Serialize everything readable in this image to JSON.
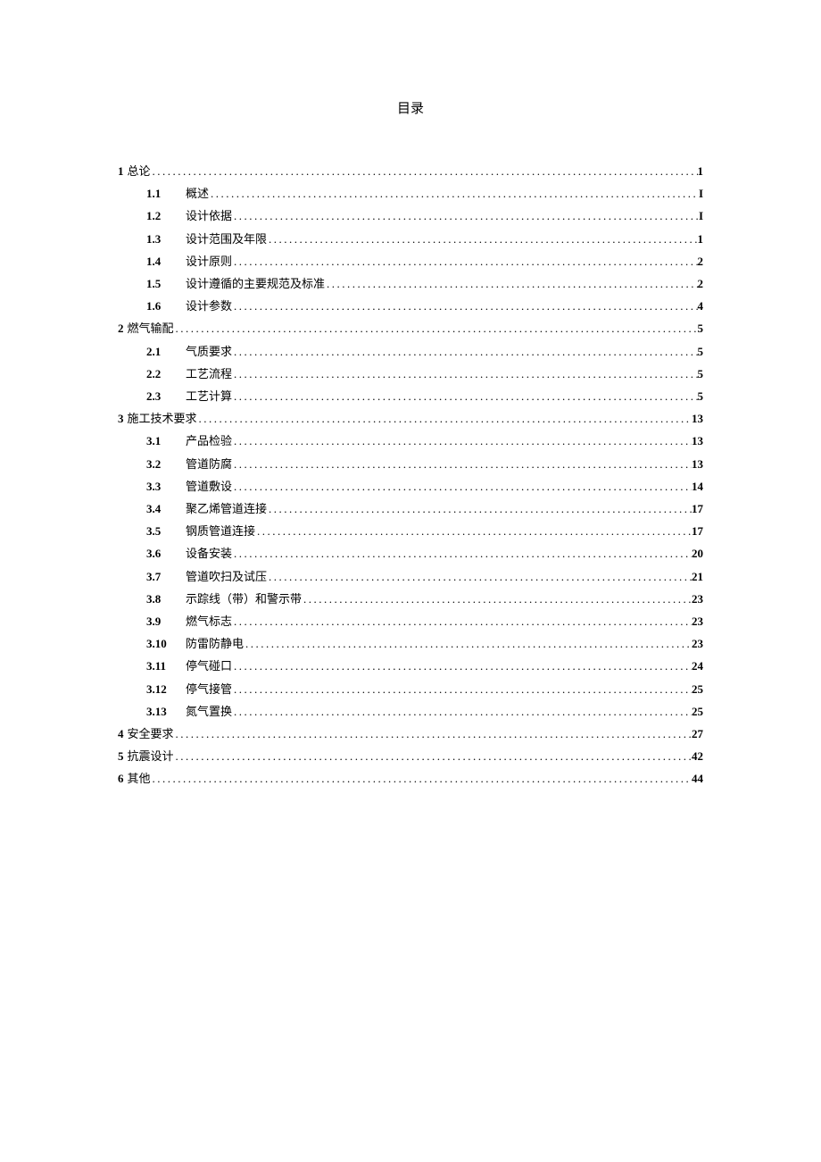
{
  "title": "目录",
  "entries": [
    {
      "level": 1,
      "num": "1",
      "text": "总论",
      "page": "1",
      "boldText": false
    },
    {
      "level": 2,
      "num": "1.1",
      "text": "概述",
      "page": "I",
      "boldText": false
    },
    {
      "level": 2,
      "num": "1.2",
      "text": "设计依据",
      "page": "I",
      "boldText": false
    },
    {
      "level": 2,
      "num": "1.3",
      "text": "设计范围及年限",
      "page": "1",
      "boldText": false
    },
    {
      "level": 2,
      "num": "1.4",
      "text": "设计原则",
      "page": "2",
      "boldText": false
    },
    {
      "level": 2,
      "num": "1.5",
      "text": "设计遵循的主要规范及标准",
      "page": "2",
      "boldText": false
    },
    {
      "level": 2,
      "num": "1.6",
      "text": "设计参数",
      "page": "4",
      "boldText": false
    },
    {
      "level": 1,
      "num": "2",
      "text": "燃气输配",
      "page": "5",
      "boldText": false
    },
    {
      "level": 2,
      "num": "2.1",
      "text": "气质要求",
      "page": "5",
      "boldText": false
    },
    {
      "level": 2,
      "num": "2.2",
      "text": "工艺流程",
      "page": "5",
      "boldText": false
    },
    {
      "level": 2,
      "num": "2.3",
      "text": "工艺计算",
      "page": "5",
      "boldText": false
    },
    {
      "level": 1,
      "num": "3",
      "text": "施工技术要求",
      "page": "13",
      "boldText": false
    },
    {
      "level": 2,
      "num": "3.1",
      "text": "产品检验",
      "page": "13",
      "boldText": false
    },
    {
      "level": 2,
      "num": "3.2",
      "text": "管道防腐",
      "page": "13",
      "boldText": false
    },
    {
      "level": 2,
      "num": "3.3",
      "text": "管道敷设",
      "page": "14",
      "boldText": false
    },
    {
      "level": 2,
      "num": "3.4",
      "text": "聚乙烯管道连接",
      "page": "17",
      "boldText": false
    },
    {
      "level": 2,
      "num": "3.5",
      "text": "钢质管道连接",
      "page": "17",
      "boldText": false
    },
    {
      "level": 2,
      "num": "3.6",
      "text": "设备安装",
      "page": "20",
      "boldText": false
    },
    {
      "level": 2,
      "num": "3.7",
      "text": "管道吹扫及试压",
      "page": "21",
      "boldText": false
    },
    {
      "level": 2,
      "num": "3.8",
      "text": "示踪线（带）和警示带",
      "page": "23",
      "boldText": false
    },
    {
      "level": 2,
      "num": "3.9",
      "text": "燃气标志",
      "page": "23",
      "boldText": false
    },
    {
      "level": 2,
      "num": "3.10",
      "text": "防雷防静电",
      "page": "23",
      "boldText": false
    },
    {
      "level": 2,
      "num": "3.11",
      "text": "停气碰口",
      "page": "24",
      "boldText": false
    },
    {
      "level": 2,
      "num": "3.12",
      "text": "停气接管",
      "page": "25",
      "boldText": false
    },
    {
      "level": 2,
      "num": "3.13",
      "text": "氮气置换",
      "page": "25",
      "boldText": false
    },
    {
      "level": 1,
      "num": "4",
      "text": "安全要求",
      "page": "27",
      "boldText": false
    },
    {
      "level": 1,
      "num": "5",
      "text": "抗震设计",
      "page": "42",
      "boldText": false
    },
    {
      "level": 1,
      "num": "6",
      "text": "其他",
      "page": "44",
      "boldText": false
    }
  ]
}
